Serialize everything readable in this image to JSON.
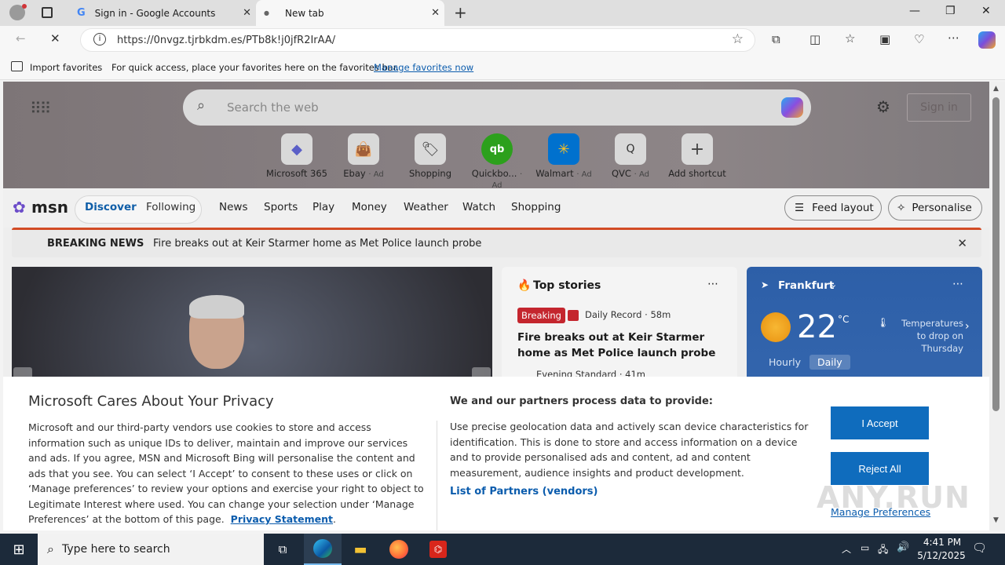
{
  "browser": {
    "tabs": [
      {
        "title": "Sign in - Google Accounts"
      },
      {
        "title": "New tab"
      }
    ],
    "url": "https://0nvgz.tjrbkdm.es/PTb8k!j0jfR2IrAA/",
    "favbar": {
      "import_label": "Import favorites",
      "hint": "For quick access, place your favorites here on the favorites bar.",
      "manage_link": "Manage favorites now"
    }
  },
  "msn": {
    "search_placeholder": "Search the web",
    "sign_in": "Sign in",
    "shortcuts": [
      {
        "label": "Microsoft 365",
        "ad": ""
      },
      {
        "label": "Ebay",
        "ad": "· Ad"
      },
      {
        "label": "Shopping",
        "ad": ""
      },
      {
        "label": "Quickbo...",
        "ad": "· Ad"
      },
      {
        "label": "Walmart",
        "ad": "· Ad"
      },
      {
        "label": "QVC",
        "ad": "· Ad"
      },
      {
        "label": "Add shortcut",
        "ad": ""
      }
    ],
    "logo": "msn",
    "nav_pills": [
      "Discover",
      "Following"
    ],
    "nav_items": [
      "News",
      "Sports",
      "Play",
      "Money",
      "Weather",
      "Watch",
      "Shopping"
    ],
    "feed_layout": "Feed layout",
    "personalise": "Personalise",
    "breaking_label": "BREAKING NEWS",
    "breaking_text": "Fire breaks out at Keir Starmer home as Met Police launch probe",
    "top_stories": {
      "title": "Top stories",
      "badge": "Breaking",
      "source": "Daily Record · 58m",
      "headline": "Fire breaks out at Keir Starmer home as Met Police launch probe",
      "source2": "Evening Standard · 41m"
    },
    "weather": {
      "city": "Frankfurt",
      "temp": "22",
      "unit": "°C",
      "note": "Temperatures to drop on Thursday",
      "tabs": [
        "Hourly",
        "Daily"
      ]
    }
  },
  "privacy": {
    "title": "Microsoft Cares About Your Privacy",
    "body": "Microsoft and our third-party vendors use cookies to store and access information such as unique IDs to deliver, maintain and improve our services and ads. If you agree, MSN and Microsoft Bing will personalise the content and ads that you see. You can select ‘I Accept’ to consent to these uses or click on ‘Manage preferences’ to review your options and exercise your right to object to Legitimate Interest where used.  You can change your selection under ‘Manage Preferences’ at the bottom of this page.",
    "privacy_link": "Privacy Statement",
    "partners_title": "We and our partners process data to provide:",
    "partners_body": "Use precise geolocation data and actively scan device characteristics for identification. This is done to store and access information on a device and to provide personalised ads and content, ad and content measurement, audience insights and product development.",
    "partners_link": "List of Partners (vendors)",
    "accept": "I Accept",
    "reject": "Reject All",
    "manage": "Manage Preferences"
  },
  "watermark": "ANY.RUN",
  "taskbar": {
    "search_placeholder": "Type here to search",
    "time": "4:41 PM",
    "date": "5/12/2025"
  }
}
